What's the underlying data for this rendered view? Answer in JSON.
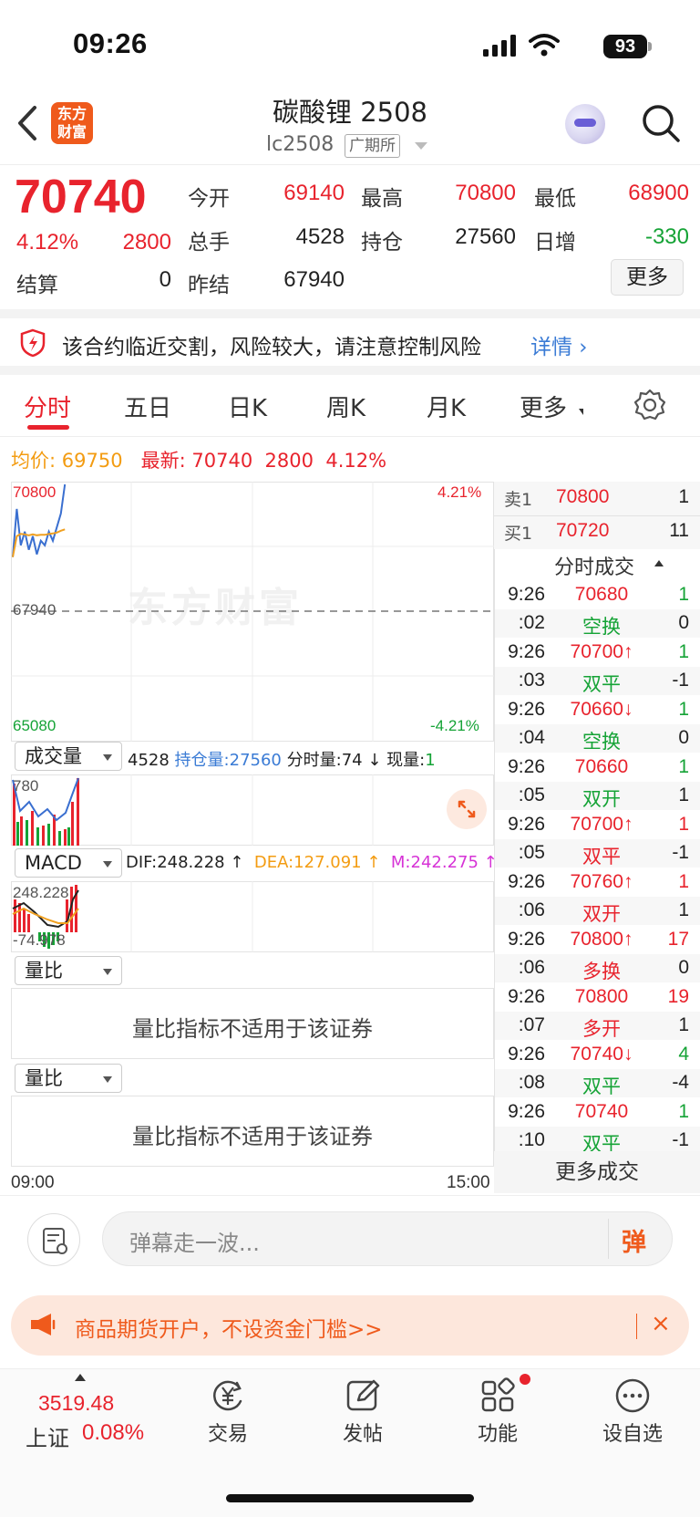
{
  "status_bar": {
    "time": "09:26",
    "battery": "93"
  },
  "header": {
    "logo_text_1": "东方",
    "logo_text_2": "财富",
    "title": "碳酸锂 2508",
    "code": "lc2508",
    "exchange": "广期所"
  },
  "quote": {
    "price": "70740",
    "change_pct": "4.12%",
    "change": "2800",
    "fields": {
      "open_label": "今开",
      "open": "69140",
      "high_label": "最高",
      "high": "70800",
      "low_label": "最低",
      "low": "68900",
      "volume_label": "总手",
      "volume": "4528",
      "oi_label": "持仓",
      "oi": "27560",
      "oi_change_label": "日增",
      "oi_change": "-330",
      "settle_label": "结算",
      "settle": "0",
      "prev_settle_label": "昨结",
      "prev_settle": "67940"
    },
    "more_label": "更多"
  },
  "warning": {
    "text": "该合约临近交割，风险较大，请注意控制风险",
    "link": "详情"
  },
  "tabs": [
    {
      "label": "分时"
    },
    {
      "label": "五日"
    },
    {
      "label": "日K"
    },
    {
      "label": "周K"
    },
    {
      "label": "月K"
    },
    {
      "label": "更多"
    }
  ],
  "avg_line": {
    "avg_label": "均价:",
    "avg": "69750",
    "last_label": "最新:",
    "last": "70740",
    "change": "2800",
    "pct": "4.12%"
  },
  "chart": {
    "watermark": "东方财富",
    "price_high": "70800",
    "price_mid": "67940",
    "price_low": "65080",
    "pct_high": "4.21%",
    "pct_low": "-4.21%",
    "time_start": "09:00",
    "time_end": "15:00"
  },
  "chart_data": {
    "type": "line",
    "x_range": [
      "09:00",
      "15:00"
    ],
    "ylim": [
      65080,
      70800
    ],
    "reference": 67940,
    "series": [
      {
        "name": "",
        "values": [
          69140,
          70200,
          69400,
          69700,
          69300,
          69600,
          69200,
          69500,
          69400,
          69700,
          69500,
          69800,
          70100,
          70740
        ],
        "color": "#3a6fd0"
      },
      {
        "name": "均价",
        "values": [
          69140,
          69600,
          69650,
          69640,
          69620,
          69640,
          69620,
          69630,
          69630,
          69650,
          69660,
          69680,
          69720,
          69750
        ],
        "color": "#f0a020"
      }
    ]
  },
  "volume_panel": {
    "selector": "成交量",
    "vol": "4528",
    "oi_label": "持仓量:",
    "oi": "27560",
    "tick_vol_label": "分时量:",
    "tick_vol": "74 ↓",
    "cur_label": "现量:",
    "cur": "1",
    "axis_top": "780"
  },
  "macd_panel": {
    "selector": "MACD",
    "dif": "DIF:248.228 ↑",
    "dea": "DEA:127.091 ↑",
    "m": "M:242.275 ↑",
    "axis_top": "248.228",
    "axis_bottom": "-74.978"
  },
  "ratio_panels": [
    {
      "selector": "量比",
      "message": "量比指标不适用于该证券"
    },
    {
      "selector": "量比",
      "message": "量比指标不适用于该证券"
    }
  ],
  "order_book": [
    {
      "label": "卖1",
      "price": "70800",
      "vol": "1"
    },
    {
      "label": "买1",
      "price": "70720",
      "vol": "11"
    }
  ],
  "ticks_title": "分时成交",
  "ticks": [
    {
      "time": "9:26",
      "price": "70680",
      "vol": "1",
      "sub_time": ":02",
      "kind": "空换",
      "delta": "0",
      "pc": "red",
      "kc": "green",
      "vc": "green"
    },
    {
      "time": "9:26",
      "price": "70700↑",
      "vol": "1",
      "sub_time": ":03",
      "kind": "双平",
      "delta": "-1",
      "pc": "red",
      "kc": "green",
      "vc": "green"
    },
    {
      "time": "9:26",
      "price": "70660↓",
      "vol": "1",
      "sub_time": ":04",
      "kind": "空换",
      "delta": "0",
      "pc": "red",
      "kc": "green",
      "vc": "green"
    },
    {
      "time": "9:26",
      "price": "70660",
      "vol": "1",
      "sub_time": ":05",
      "kind": "双开",
      "delta": "1",
      "pc": "red",
      "kc": "green",
      "vc": "green"
    },
    {
      "time": "9:26",
      "price": "70700↑",
      "vol": "1",
      "sub_time": ":05",
      "kind": "双平",
      "delta": "-1",
      "pc": "red",
      "kc": "red",
      "vc": "red"
    },
    {
      "time": "9:26",
      "price": "70760↑",
      "vol": "1",
      "sub_time": ":06",
      "kind": "双开",
      "delta": "1",
      "pc": "red",
      "kc": "red",
      "vc": "red"
    },
    {
      "time": "9:26",
      "price": "70800↑",
      "vol": "17",
      "sub_time": ":06",
      "kind": "多换",
      "delta": "0",
      "pc": "red",
      "kc": "red",
      "vc": "red"
    },
    {
      "time": "9:26",
      "price": "70800",
      "vol": "19",
      "sub_time": ":07",
      "kind": "多开",
      "delta": "1",
      "pc": "red",
      "kc": "red",
      "vc": "red"
    },
    {
      "time": "9:26",
      "price": "70740↓",
      "vol": "4",
      "sub_time": ":08",
      "kind": "双平",
      "delta": "-4",
      "pc": "red",
      "kc": "green",
      "vc": "green"
    },
    {
      "time": "9:26",
      "price": "70740",
      "vol": "1",
      "sub_time": ":10",
      "kind": "双平",
      "delta": "-1",
      "pc": "red",
      "kc": "green",
      "vc": "green"
    }
  ],
  "more_trades": "更多成交",
  "comment": {
    "placeholder": "弹幕走一波...",
    "send": "弹"
  },
  "promo": {
    "text": "商品期货开户，不设资金门槛>>",
    "close": "×"
  },
  "bottom_nav": {
    "index_value": "3519.48",
    "index_name": "上证",
    "index_pct": "0.08%",
    "items": [
      {
        "label": "交易"
      },
      {
        "label": "发帖"
      },
      {
        "label": "功能"
      },
      {
        "label": "设自选"
      }
    ]
  }
}
